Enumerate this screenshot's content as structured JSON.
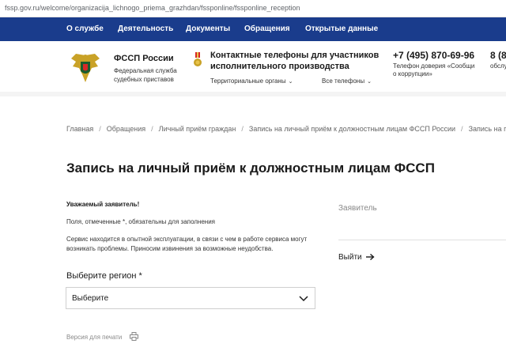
{
  "browser": {
    "url": "fssp.gov.ru/welcome/organizacija_lichnogo_priema_grazhdan/fssponline/fssponline_reception"
  },
  "nav": {
    "items": [
      {
        "label": "О службе"
      },
      {
        "label": "Деятельность"
      },
      {
        "label": "Документы"
      },
      {
        "label": "Обращения"
      },
      {
        "label": "Открытые данные"
      }
    ]
  },
  "header": {
    "brand_title": "ФССП России",
    "brand_subtitle": "Федеральная служба судебных приставов",
    "contacts_title": "Контактные телефоны для участников исполнительного производства",
    "territorial_link": "Территориальные органы",
    "all_phones_link": "Все телефоны",
    "phone": "+7 (495) 870-69-96",
    "phone_note": "Телефон доверия «Сообщи о коррупции»",
    "phone2": "8 (8",
    "phone2_note": "обслу"
  },
  "breadcrumbs": [
    "Главная",
    "Обращения",
    "Личный приём граждан",
    "Запись на личный приём к должностным лицам ФССП России",
    "Запись на пр"
  ],
  "main": {
    "title": "Запись на личный приём к должностным лицам ФССП",
    "greeting": "Уважаемый заявитель!",
    "required_note": "Поля, отмеченные *, обязательны для заполнения",
    "service_note": "Сервис находится в опытной эксплуатации, в связи с чем в работе сервиса могут возникать проблемы. Приносим извинения за возможные неудобства.",
    "region_label": "Выберите регион *",
    "region_value": "Выберите",
    "print_label": "Версия для печати"
  },
  "side": {
    "applicant_label": "Заявитель",
    "logout_label": "Выйти"
  },
  "colors": {
    "nav_bg": "#1a3c8c",
    "text": "#1a1a1a",
    "muted": "#888888"
  }
}
